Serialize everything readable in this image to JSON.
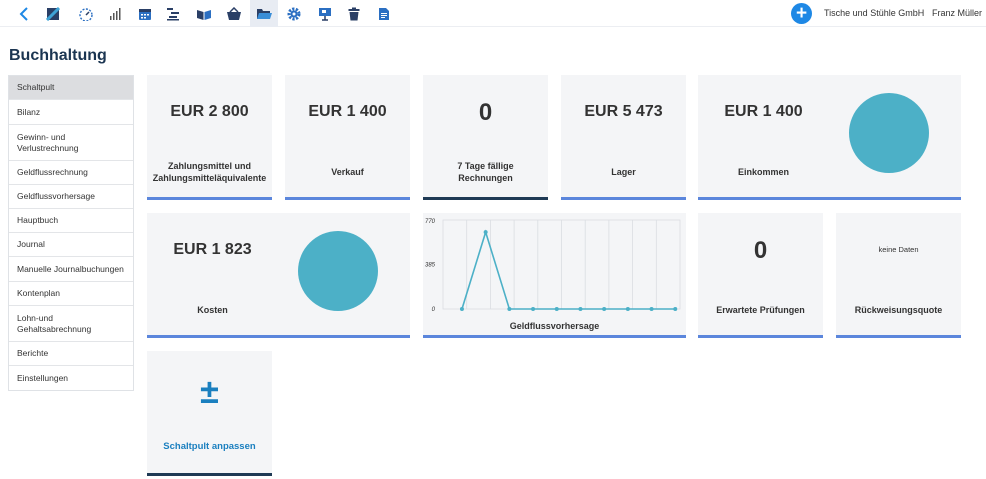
{
  "topbar": {
    "icons": [
      "back-icon",
      "book-icon",
      "gauge-icon",
      "bar-chart-icon",
      "calendar-icon",
      "list-icon",
      "open-book-icon",
      "basket-icon",
      "folder-icon",
      "gear-icon",
      "presentation-icon",
      "trash-icon",
      "document-icon"
    ],
    "company": "Tische und Stühle GmbH",
    "user": "Franz Müller",
    "accent": "#1e88e5"
  },
  "page": {
    "title": "Buchhaltung"
  },
  "sidebar": {
    "items": [
      {
        "label": "Schaltpult"
      },
      {
        "label": "Bilanz"
      },
      {
        "label": "Gewinn- und Verlustrechnung"
      },
      {
        "label": "Geldflussrechnung"
      },
      {
        "label": "Geldflussvorhersage"
      },
      {
        "label": "Hauptbuch"
      },
      {
        "label": "Journal"
      },
      {
        "label": "Manuelle Journalbuchungen"
      },
      {
        "label": "Kontenplan"
      },
      {
        "label": "Lohn-und Gehaltsabrechnung"
      },
      {
        "label": "Berichte"
      },
      {
        "label": "Einstellungen"
      }
    ]
  },
  "tiles": {
    "cash": {
      "value": "EUR 2 800",
      "label": "Zahlungsmittel und Zahlungsmitteläquivalente"
    },
    "sales": {
      "value": "EUR 1 400",
      "label": "Verkauf"
    },
    "due": {
      "value": "0",
      "label": "7 Tage fällige Rechnungen"
    },
    "stock": {
      "value": "EUR 5 473",
      "label": "Lager"
    },
    "income": {
      "value": "EUR 1 400",
      "label": "Einkommen"
    },
    "costs": {
      "value": "EUR 1 823",
      "label": "Kosten"
    },
    "cashflow": {
      "label": "Geldflussvorhersage"
    },
    "checks": {
      "value": "0",
      "label": "Erwartete Prüfungen"
    },
    "returns": {
      "value": "keine Daten",
      "label": "Rückweisungsquote"
    },
    "customize": {
      "label": "Schaltpult anpassen",
      "icon": "plus-minus-icon"
    }
  },
  "chart_data": {
    "type": "line",
    "x": [
      1,
      2,
      3,
      4,
      5,
      6,
      7,
      8,
      9,
      10
    ],
    "values": [
      0,
      665,
      0,
      0,
      0,
      0,
      0,
      0,
      0,
      0
    ],
    "yticks": [
      "0",
      "385",
      "770"
    ],
    "ylim": [
      0,
      770
    ],
    "grid": true,
    "color": "#4cb0c7"
  }
}
